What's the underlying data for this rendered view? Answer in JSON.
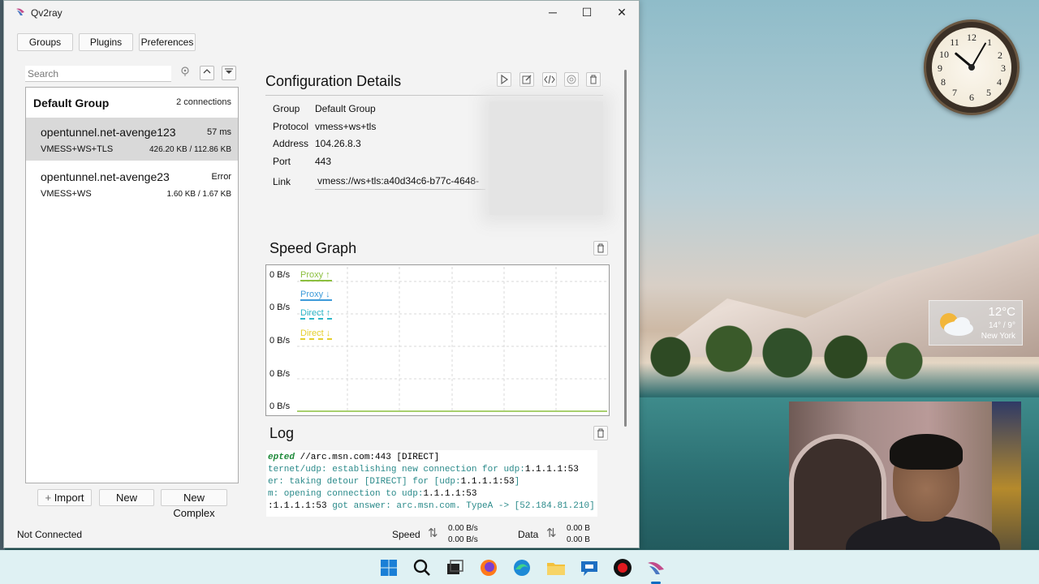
{
  "window": {
    "title": "Qv2ray",
    "minimize_glyph": "─",
    "maximize_glyph": "☐",
    "close_glyph": "✕"
  },
  "toolbar": {
    "groups": "Groups",
    "plugins": "Plugins",
    "preferences": "Preferences"
  },
  "search": {
    "placeholder": "Search",
    "value": ""
  },
  "group": {
    "name": "Default Group",
    "count": "2 connections"
  },
  "connections": [
    {
      "name": "opentunnel.net-avenge123",
      "latency": "57 ms",
      "type": "VMESS+WS+TLS",
      "usage": "426.20 KB / 112.86 KB",
      "selected": true
    },
    {
      "name": "opentunnel.net-avenge23",
      "latency": "Error",
      "type": "VMESS+WS",
      "usage": "1.60 KB / 1.67 KB",
      "selected": false
    }
  ],
  "bottom_buttons": {
    "import": "Import",
    "new": "New",
    "new_complex": "New Complex"
  },
  "details": {
    "title": "Configuration Details",
    "labels": {
      "group": "Group",
      "protocol": "Protocol",
      "address": "Address",
      "port": "Port",
      "link": "Link"
    },
    "values": {
      "group": "Default Group",
      "protocol": "vmess+ws+tls",
      "address": "104.26.8.3",
      "port": "443",
      "link": "vmess://ws+tls:a40d34c6-b77c-4648-"
    }
  },
  "speed_graph": {
    "title": "Speed Graph",
    "y_labels": [
      "0 B/s",
      "0 B/s",
      "0 B/s",
      "0 B/s",
      "0 B/s"
    ],
    "legend": [
      {
        "name": "Proxy ↑",
        "color": "#8cbf3f"
      },
      {
        "name": "Proxy ↓",
        "color": "#3d9bd9"
      },
      {
        "name": "Direct ↑",
        "color": "#2fb7c9"
      },
      {
        "name": "Direct ↓",
        "color": "#e5cf2e"
      }
    ]
  },
  "log": {
    "title": "Log",
    "lines": [
      [
        [
          "lg",
          "epted "
        ],
        [
          "lk",
          "//arc.msn.com:443 [DIRECT]"
        ]
      ],
      [
        [
          "lt",
          "ternet/udp: establishing new connection for udp:"
        ],
        [
          "lk",
          "1.1.1.1:53"
        ]
      ],
      [
        [
          "lt",
          "er: taking detour [DIRECT] for [udp:"
        ],
        [
          "lk",
          "1.1.1.1:53"
        ],
        [
          "lt",
          "]"
        ]
      ],
      [
        [
          "lt",
          "m: opening connection to udp:"
        ],
        [
          "lk",
          "1.1.1.1:53"
        ]
      ],
      [
        [
          "lk",
          ":1.1.1.1:53 "
        ],
        [
          "lt",
          "got answer: arc.msn.com. TypeA -> [52.184.81.210]"
        ]
      ]
    ]
  },
  "status": {
    "connection": "Not Connected",
    "speed_label": "Speed",
    "speed_up": "0.00 B/s",
    "speed_down": "0.00 B/s",
    "data_label": "Data",
    "data_up": "0.00 B",
    "data_down": "0.00 B"
  },
  "desktop": {
    "clock_numbers": [
      "12",
      "1",
      "2",
      "3",
      "4",
      "5",
      "6",
      "7",
      "8",
      "9",
      "10",
      "11"
    ],
    "weather": {
      "temp": "12°C",
      "range": "14° / 9°",
      "city": "New York"
    }
  },
  "taskbar": {
    "icons": [
      "windows-start-icon",
      "search-icon",
      "task-view-icon",
      "firefox-icon",
      "edge-icon",
      "file-explorer-icon",
      "chat-icon",
      "record-icon",
      "qv2ray-icon"
    ]
  }
}
